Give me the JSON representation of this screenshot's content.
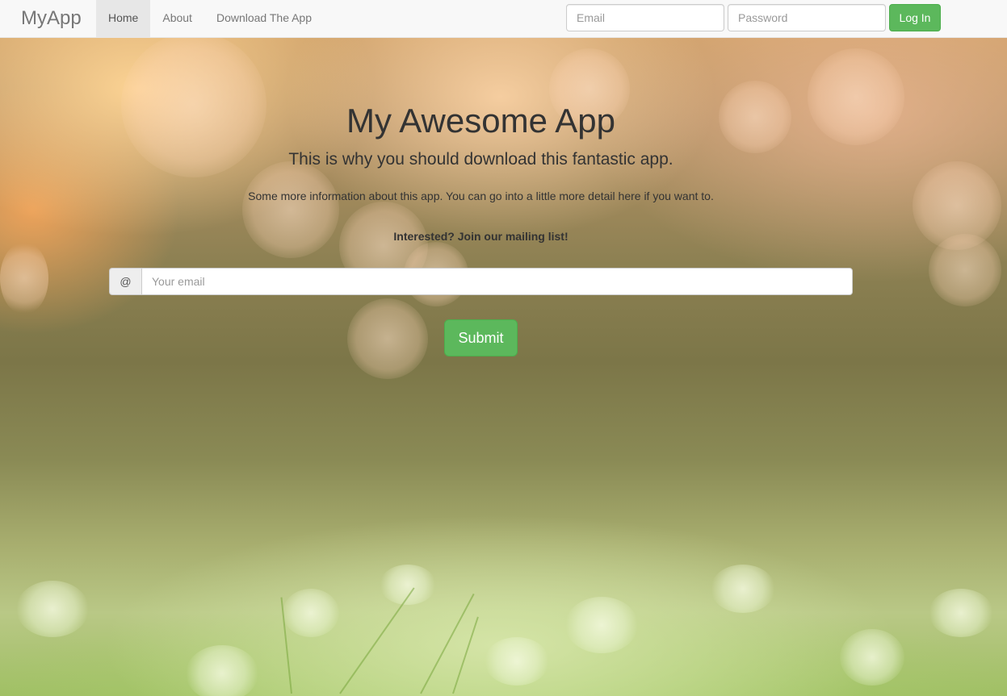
{
  "navbar": {
    "brand": "MyApp",
    "links": [
      {
        "label": "Home",
        "active": true
      },
      {
        "label": "About",
        "active": false
      },
      {
        "label": "Download The App",
        "active": false
      }
    ],
    "login": {
      "email_placeholder": "Email",
      "password_placeholder": "Password",
      "button_label": "Log In"
    }
  },
  "hero": {
    "title": "My Awesome App",
    "subtitle": "This is why you should download this fantastic app.",
    "info": "Some more information about this app. You can go into a little more detail here if you want to.",
    "cta": "Interested? Join our mailing list!",
    "signup": {
      "addon": "@",
      "email_placeholder": "Your email",
      "submit_label": "Submit"
    }
  },
  "colors": {
    "primary_button": "#5cb85c",
    "navbar_bg": "#f8f8f8",
    "text": "#333333"
  }
}
